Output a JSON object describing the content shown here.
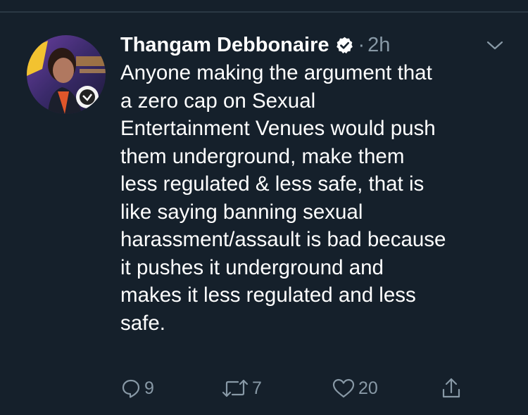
{
  "tweet": {
    "author_name": "Thangam Debbonaire",
    "verified_icon": "verified-badge-icon",
    "separator": "·",
    "time": "2h",
    "text": "Anyone making the argument that\na zero cap on Sexual\nEntertainment Venues would push\nthem underground, make them\nless regulated & less safe, that is\nlike saying banning sexual\nharassment/assault is bad because\nit pushes it underground and\nmakes it less regulated and less\nsafe."
  },
  "actions": {
    "reply_count": "9",
    "retweet_count": "7",
    "like_count": "20"
  },
  "colors": {
    "background": "#15202b",
    "text_primary": "#ffffff",
    "text_secondary": "#8899a6",
    "divider": "#2b3844"
  },
  "icons": {
    "reply": "reply-icon",
    "retweet": "retweet-icon",
    "like": "heart-icon",
    "share": "share-icon",
    "menu": "chevron-down-icon"
  }
}
